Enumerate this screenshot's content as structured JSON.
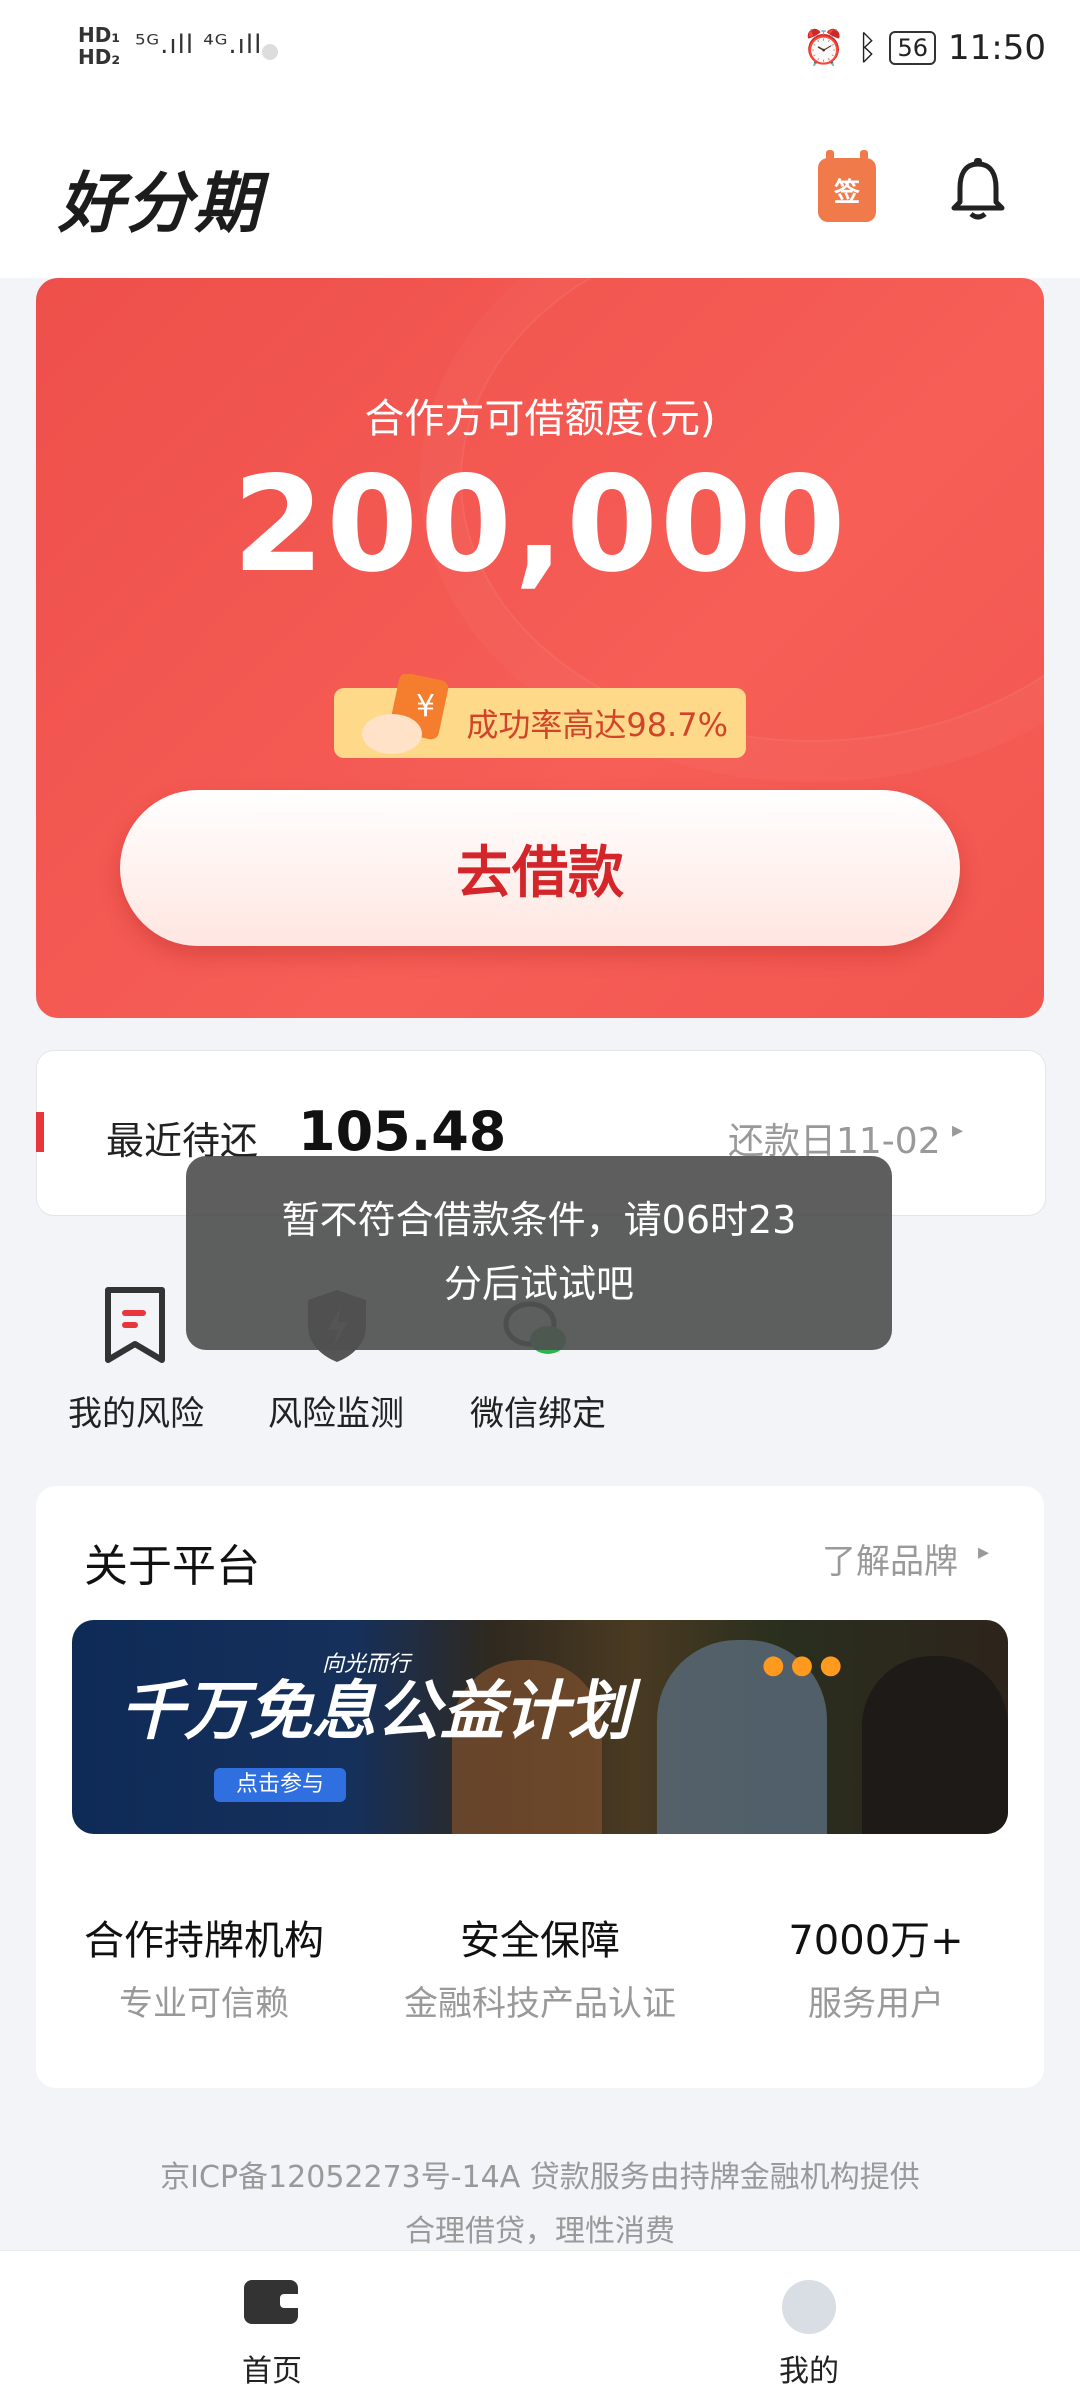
{
  "status_bar": {
    "sim_left": "HD₁\nHD₂",
    "signal": "⁵ᴳ.ıll ⁴ᴳ.ıll",
    "battery": "56",
    "time": "11:50"
  },
  "header": {
    "logo": "好分期",
    "sign_icon_text": "签"
  },
  "quota_card": {
    "label": "合作方可借额度(元)",
    "amount": "200,000",
    "success_tag": "成功率高达98.7%",
    "coin_symbol": "¥",
    "borrow_button": "去借款",
    "accent_color": "#f2564f"
  },
  "repay": {
    "label": "最近待还",
    "amount": "105.48",
    "due_date": "还款日11-02",
    "arrow": "▸"
  },
  "quick_actions": [
    {
      "label": "我的风险",
      "icon": "bookmark-icon"
    },
    {
      "label": "风险监测",
      "icon": "shield-lightning-icon"
    },
    {
      "label": "微信绑定",
      "icon": "wechat-icon"
    }
  ],
  "toast": {
    "line1": "暂不符合借款条件，请06时23",
    "line2": "分后试试吧"
  },
  "about": {
    "title": "关于平台",
    "more": "了解品牌",
    "arrow": "▸",
    "banner": {
      "title": "千万免息公益计划",
      "subtitle": "向光而行",
      "button": "点击参与"
    },
    "features": [
      {
        "title": "合作持牌机构",
        "sub": "专业可信赖"
      },
      {
        "title": "安全保障",
        "sub": "金融科技产品认证"
      },
      {
        "title": "7000万+",
        "sub": "服务用户"
      }
    ]
  },
  "footer": {
    "line1": "京ICP备12052273号-14A 贷款服务由持牌金融机构提供",
    "line2": "合理借贷，理性消费"
  },
  "bottom_nav": {
    "home": "首页",
    "me": "我的"
  }
}
